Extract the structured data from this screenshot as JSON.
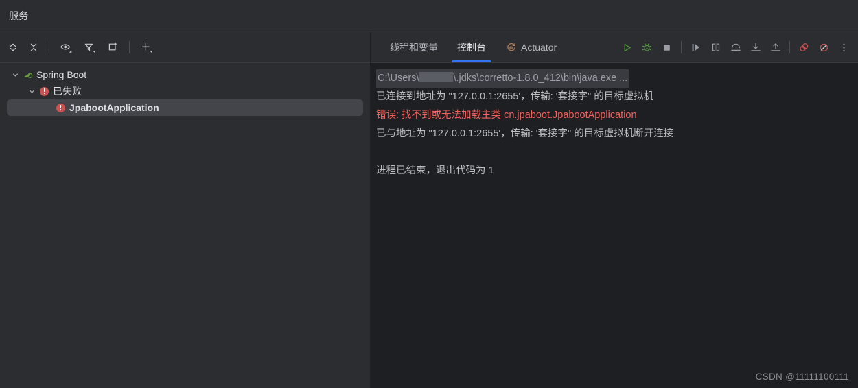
{
  "window": {
    "title": "服务"
  },
  "left_toolbar": {
    "buttons": [
      {
        "name": "expand-collapse-button",
        "icon": "chevrons-up-down-icon",
        "label": ""
      },
      {
        "name": "collapse-all-button",
        "icon": "collapse-all-icon",
        "label": ""
      },
      {
        "name": "show-hide-button",
        "icon": "eye-icon",
        "label": ""
      },
      {
        "name": "filter-button",
        "icon": "filter-icon",
        "label": ""
      },
      {
        "name": "open-in-new-tab-button",
        "icon": "add-tab-icon",
        "label": ""
      },
      {
        "name": "add-service-button",
        "icon": "plus-icon",
        "label": ""
      }
    ]
  },
  "tree": {
    "nodes": [
      {
        "label": "Spring Boot",
        "icon": "spring-boot-leaf-icon",
        "level": 0,
        "expanded": true,
        "selected": false
      },
      {
        "label": "已失败",
        "icon": "error-icon",
        "level": 1,
        "expanded": true,
        "selected": false
      },
      {
        "label": "JpabootApplication",
        "icon": "error-icon",
        "level": 2,
        "expanded": false,
        "selected": true
      }
    ]
  },
  "right_panel": {
    "tabs": [
      {
        "label": "线程和变量",
        "icon": "",
        "active": false
      },
      {
        "label": "控制台",
        "icon": "",
        "active": true
      },
      {
        "label": "Actuator",
        "icon": "actuator-gauge-icon",
        "active": false
      }
    ],
    "run_toolbar": [
      {
        "name": "run-button",
        "icon": "play-icon"
      },
      {
        "name": "debug-button",
        "icon": "bug-icon"
      },
      {
        "name": "stop-button",
        "icon": "stop-square-icon"
      },
      {
        "name": "resume-program-button",
        "icon": "resume-icon"
      },
      {
        "name": "pause-program-button",
        "icon": "pause-icon"
      },
      {
        "name": "step-over-button",
        "icon": "step-over-icon"
      },
      {
        "name": "step-into-button",
        "icon": "step-into-icon"
      },
      {
        "name": "step-out-button",
        "icon": "step-out-icon"
      },
      {
        "name": "mute-breakpoints-button",
        "icon": "mute-breakpoints-icon"
      },
      {
        "name": "view-breakpoints-button",
        "icon": "no-breakpoint-icon"
      },
      {
        "name": "more-options-button",
        "icon": "vertical-dots-icon"
      }
    ]
  },
  "console": {
    "lines": [
      {
        "type": "cmd",
        "prefix": "C:\\Users\\",
        "redacted": true,
        "suffix": "\\.jdks\\corretto-1.8.0_412\\bin\\java.exe ..."
      },
      {
        "type": "normal",
        "text": "已连接到地址为 \"127.0.0.1:2655'，传输: '套接字\" 的目标虚拟机"
      },
      {
        "type": "error",
        "text": "错误: 找不到或无法加载主类 cn.jpaboot.JpabootApplication"
      },
      {
        "type": "normal",
        "text": "已与地址为 \"127.0.0.1:2655'，传输: '套接字\" 的目标虚拟机断开连接"
      },
      {
        "type": "blank",
        "text": ""
      },
      {
        "type": "normal",
        "text": "进程已结束，退出代码为 1"
      }
    ]
  },
  "watermark": {
    "text": "CSDN @11111100111"
  },
  "colors": {
    "panel_bg": "#2b2d30",
    "console_bg": "#1e1f22",
    "accent_blue": "#3574f0",
    "error_red": "#c75450",
    "error_text": "#f4615c",
    "spring_green": "#6a9e3f",
    "actuator_orange": "#b07b54",
    "selection_bg": "#43454a",
    "text_primary": "#dfe1e5",
    "text_secondary": "#bcbec4"
  }
}
